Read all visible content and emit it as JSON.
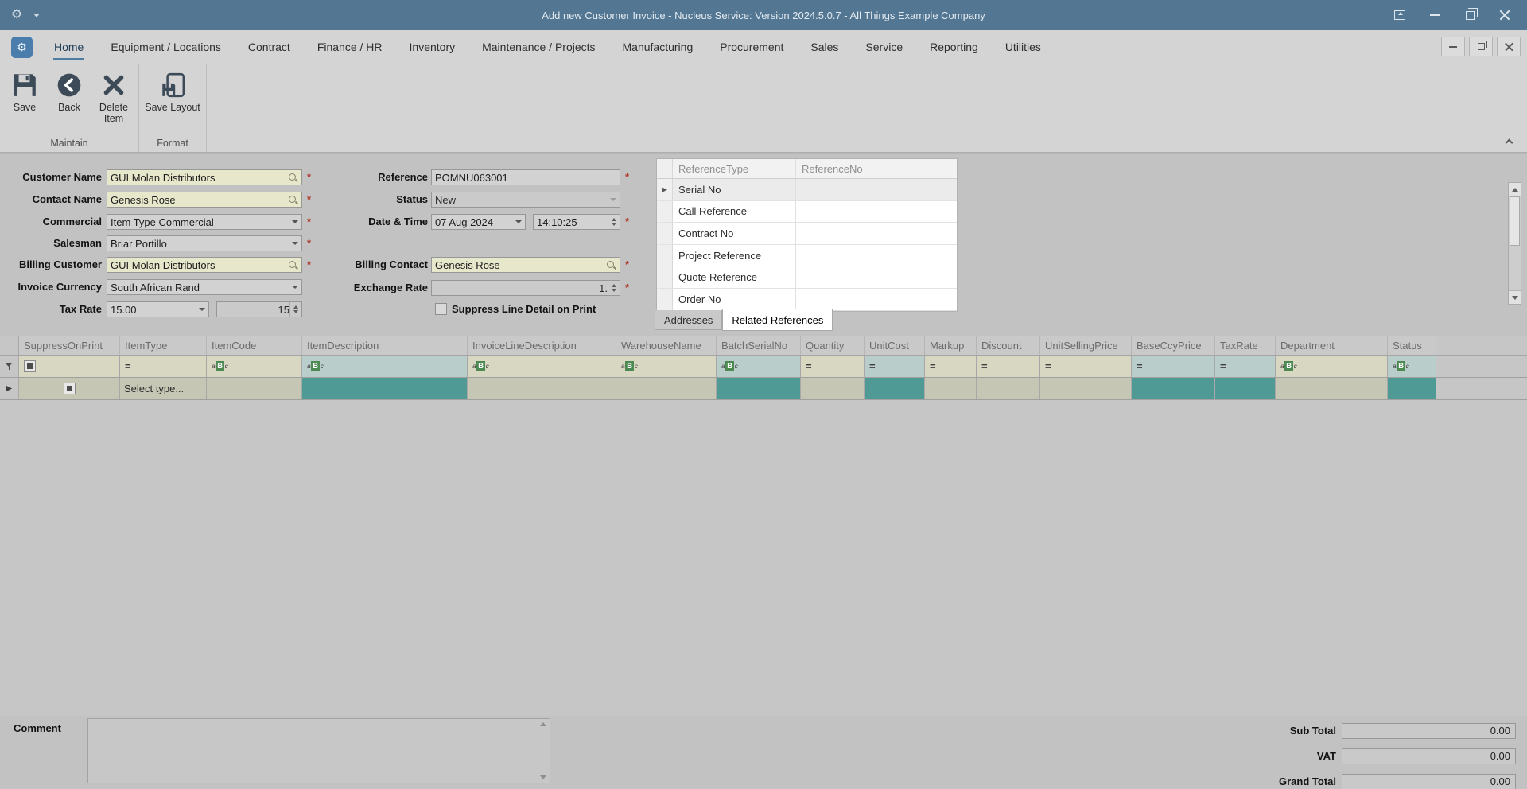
{
  "window": {
    "title": "Add new Customer Invoice - Nucleus Service: Version 2024.5.0.7 - All Things Example Company"
  },
  "ribbon": {
    "tabs": [
      {
        "label": "Home",
        "active": true
      },
      {
        "label": "Equipment / Locations",
        "active": false
      },
      {
        "label": "Contract",
        "active": false
      },
      {
        "label": "Finance / HR",
        "active": false
      },
      {
        "label": "Inventory",
        "active": false
      },
      {
        "label": "Maintenance / Projects",
        "active": false
      },
      {
        "label": "Manufacturing",
        "active": false
      },
      {
        "label": "Procurement",
        "active": false
      },
      {
        "label": "Sales",
        "active": false
      },
      {
        "label": "Service",
        "active": false
      },
      {
        "label": "Reporting",
        "active": false
      },
      {
        "label": "Utilities",
        "active": false
      }
    ],
    "buttons": {
      "save": "Save",
      "back": "Back",
      "delete_item": "Delete Item",
      "save_layout": "Save Layout"
    },
    "groups": {
      "maintain": "Maintain",
      "format": "Format"
    }
  },
  "form": {
    "customer_name": {
      "label": "Customer Name",
      "value": "GUI Molan Distributors",
      "required": true
    },
    "contact_name": {
      "label": "Contact Name",
      "value": "Genesis Rose",
      "required": true
    },
    "commercial": {
      "label": "Commercial",
      "value": "Item Type Commercial",
      "required": true
    },
    "salesman": {
      "label": "Salesman",
      "value": "Briar Portillo",
      "required": true
    },
    "billing_customer": {
      "label": "Billing Customer",
      "value": "GUI Molan Distributors",
      "required": true
    },
    "invoice_currency": {
      "label": "Invoice Currency",
      "value": "South African Rand"
    },
    "tax_rate": {
      "label": "Tax Rate",
      "value": "15.00",
      "spin_value": "15"
    },
    "reference": {
      "label": "Reference",
      "value": "POMNU063001",
      "required": true
    },
    "status": {
      "label": "Status",
      "value": "New"
    },
    "date_time": {
      "label": "Date & Time",
      "date": "07 Aug 2024",
      "time": "14:10:25",
      "required": true
    },
    "billing_contact": {
      "label": "Billing Contact",
      "value": "Genesis Rose",
      "required": true
    },
    "exchange_rate": {
      "label": "Exchange Rate",
      "value": "1.",
      "required": true
    },
    "suppress_line": {
      "label": "Suppress Line Detail on Print",
      "checked": false
    }
  },
  "reference_panel": {
    "columns": [
      "ReferenceType",
      "ReferenceNo"
    ],
    "rows": [
      {
        "type": "Serial No",
        "no": "",
        "selected": true
      },
      {
        "type": "Call Reference",
        "no": "",
        "selected": false
      },
      {
        "type": "Contract No",
        "no": "",
        "selected": false
      },
      {
        "type": "Project Reference",
        "no": "",
        "selected": false
      },
      {
        "type": "Quote Reference",
        "no": "",
        "selected": false
      },
      {
        "type": "Order No",
        "no": "",
        "selected": false
      }
    ],
    "tabs": [
      {
        "label": "Addresses",
        "active": false
      },
      {
        "label": "Related References",
        "active": true
      }
    ]
  },
  "grid": {
    "columns": [
      {
        "label": "SuppressOnPrint",
        "filter": "checkbox",
        "highlight": false
      },
      {
        "label": "ItemType",
        "filter": "equals",
        "highlight": false
      },
      {
        "label": "ItemCode",
        "filter": "abc",
        "highlight": false
      },
      {
        "label": "ItemDescription",
        "filter": "abc",
        "highlight": true
      },
      {
        "label": "InvoiceLineDescription",
        "filter": "abc",
        "highlight": false
      },
      {
        "label": "WarehouseName",
        "filter": "abc",
        "highlight": false
      },
      {
        "label": "BatchSerialNo",
        "filter": "abc",
        "highlight": true
      },
      {
        "label": "Quantity",
        "filter": "equals",
        "highlight": false
      },
      {
        "label": "UnitCost",
        "filter": "equals",
        "highlight": true
      },
      {
        "label": "Markup",
        "filter": "equals",
        "highlight": false
      },
      {
        "label": "Discount",
        "filter": "equals",
        "highlight": false
      },
      {
        "label": "UnitSellingPrice",
        "filter": "equals",
        "highlight": false
      },
      {
        "label": "BaseCcyPrice",
        "filter": "equals",
        "highlight": true
      },
      {
        "label": "TaxRate",
        "filter": "equals",
        "highlight": true
      },
      {
        "label": "Department",
        "filter": "abc",
        "highlight": false
      },
      {
        "label": "Status",
        "filter": "abc",
        "highlight": true
      }
    ],
    "new_row": {
      "item_type_placeholder": "Select type..."
    }
  },
  "footer": {
    "comment_label": "Comment",
    "comment_value": "",
    "totals": [
      {
        "label": "Sub Total",
        "value": "0.00"
      },
      {
        "label": "VAT",
        "value": "0.00"
      },
      {
        "label": "Grand Total",
        "value": "0.00"
      }
    ]
  },
  "colors": {
    "titlebar": "#537792",
    "accent_teal": "#4f9a94",
    "filter_teal": "#b9cdca",
    "cell_beige": "#c6c6b4",
    "filter_beige": "#d8d8c2",
    "lookup_field": "#e7e7cb",
    "tab_underline": "#4e7ca1",
    "required_red": "#b03a2e"
  }
}
